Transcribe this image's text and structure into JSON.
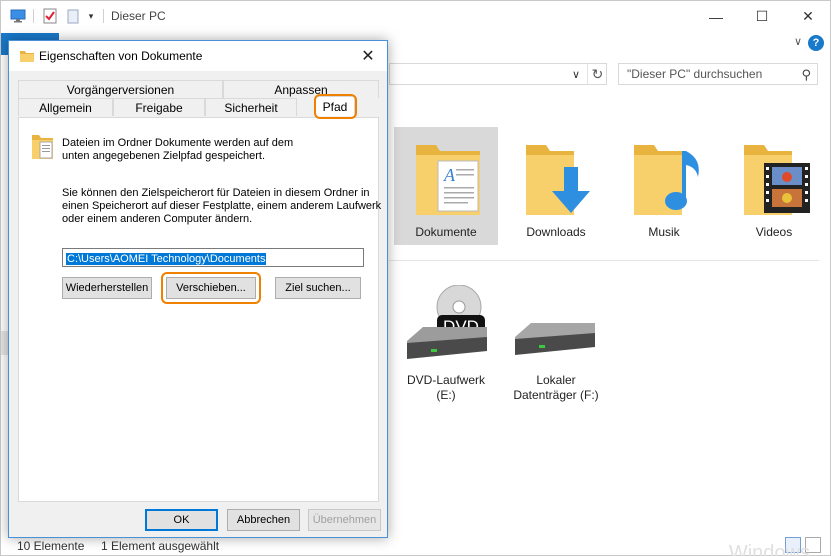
{
  "window": {
    "title": "Dieser PC",
    "minimize": "—",
    "maximize": "☐",
    "close": "✕"
  },
  "ribbon": {
    "help": "?",
    "collapse": "∨"
  },
  "address": {
    "dropdown": "∨",
    "refresh": "↻"
  },
  "search": {
    "placeholder": "\"Dieser PC\" durchsuchen",
    "icon": "⚲"
  },
  "folders": [
    {
      "label": "Dokumente",
      "selected": true
    },
    {
      "label": "Downloads",
      "selected": false
    },
    {
      "label": "Musik",
      "selected": false
    },
    {
      "label": "Videos",
      "selected": false
    }
  ],
  "drives": [
    {
      "line1": "DVD-Laufwerk",
      "line2": "(E:)",
      "badge": "DVD"
    },
    {
      "line1": "Lokaler",
      "line2": "Datenträger (F:)"
    }
  ],
  "status": {
    "count": "10 Elemente",
    "selection": "1 Element ausgewählt"
  },
  "watermark": "Windows",
  "dialog": {
    "title": "Eigenschaften von Dokumente",
    "close": "✕",
    "tabs_row1": [
      "Vorgängerversionen",
      "Anpassen"
    ],
    "tabs_row2": [
      "Allgemein",
      "Freigabe",
      "Sicherheit",
      "Pfad"
    ],
    "active_tab": "Pfad",
    "intro_line1": "Dateien im Ordner Dokumente werden auf dem",
    "intro_line2": "unten angegebenen Zielpfad gespeichert.",
    "info_line1": "Sie können den Zielspeicherort für Dateien in diesem Ordner in",
    "info_line2": "einen Speicherort auf dieser Festplatte, einem anderem Laufwerk",
    "info_line3": "oder einem anderen Computer ändern.",
    "path": "C:\\Users\\AOMEI Technology\\Documents",
    "btn_restore": "Wiederherstellen",
    "btn_move": "Verschieben...",
    "btn_find": "Ziel suchen...",
    "btn_ok": "OK",
    "btn_cancel": "Abbrechen",
    "btn_apply": "Übernehmen"
  },
  "colors": {
    "accent": "#0078d7",
    "highlight": "#f08000",
    "folder": "#f5c659",
    "selection": "#d9d9d9"
  }
}
